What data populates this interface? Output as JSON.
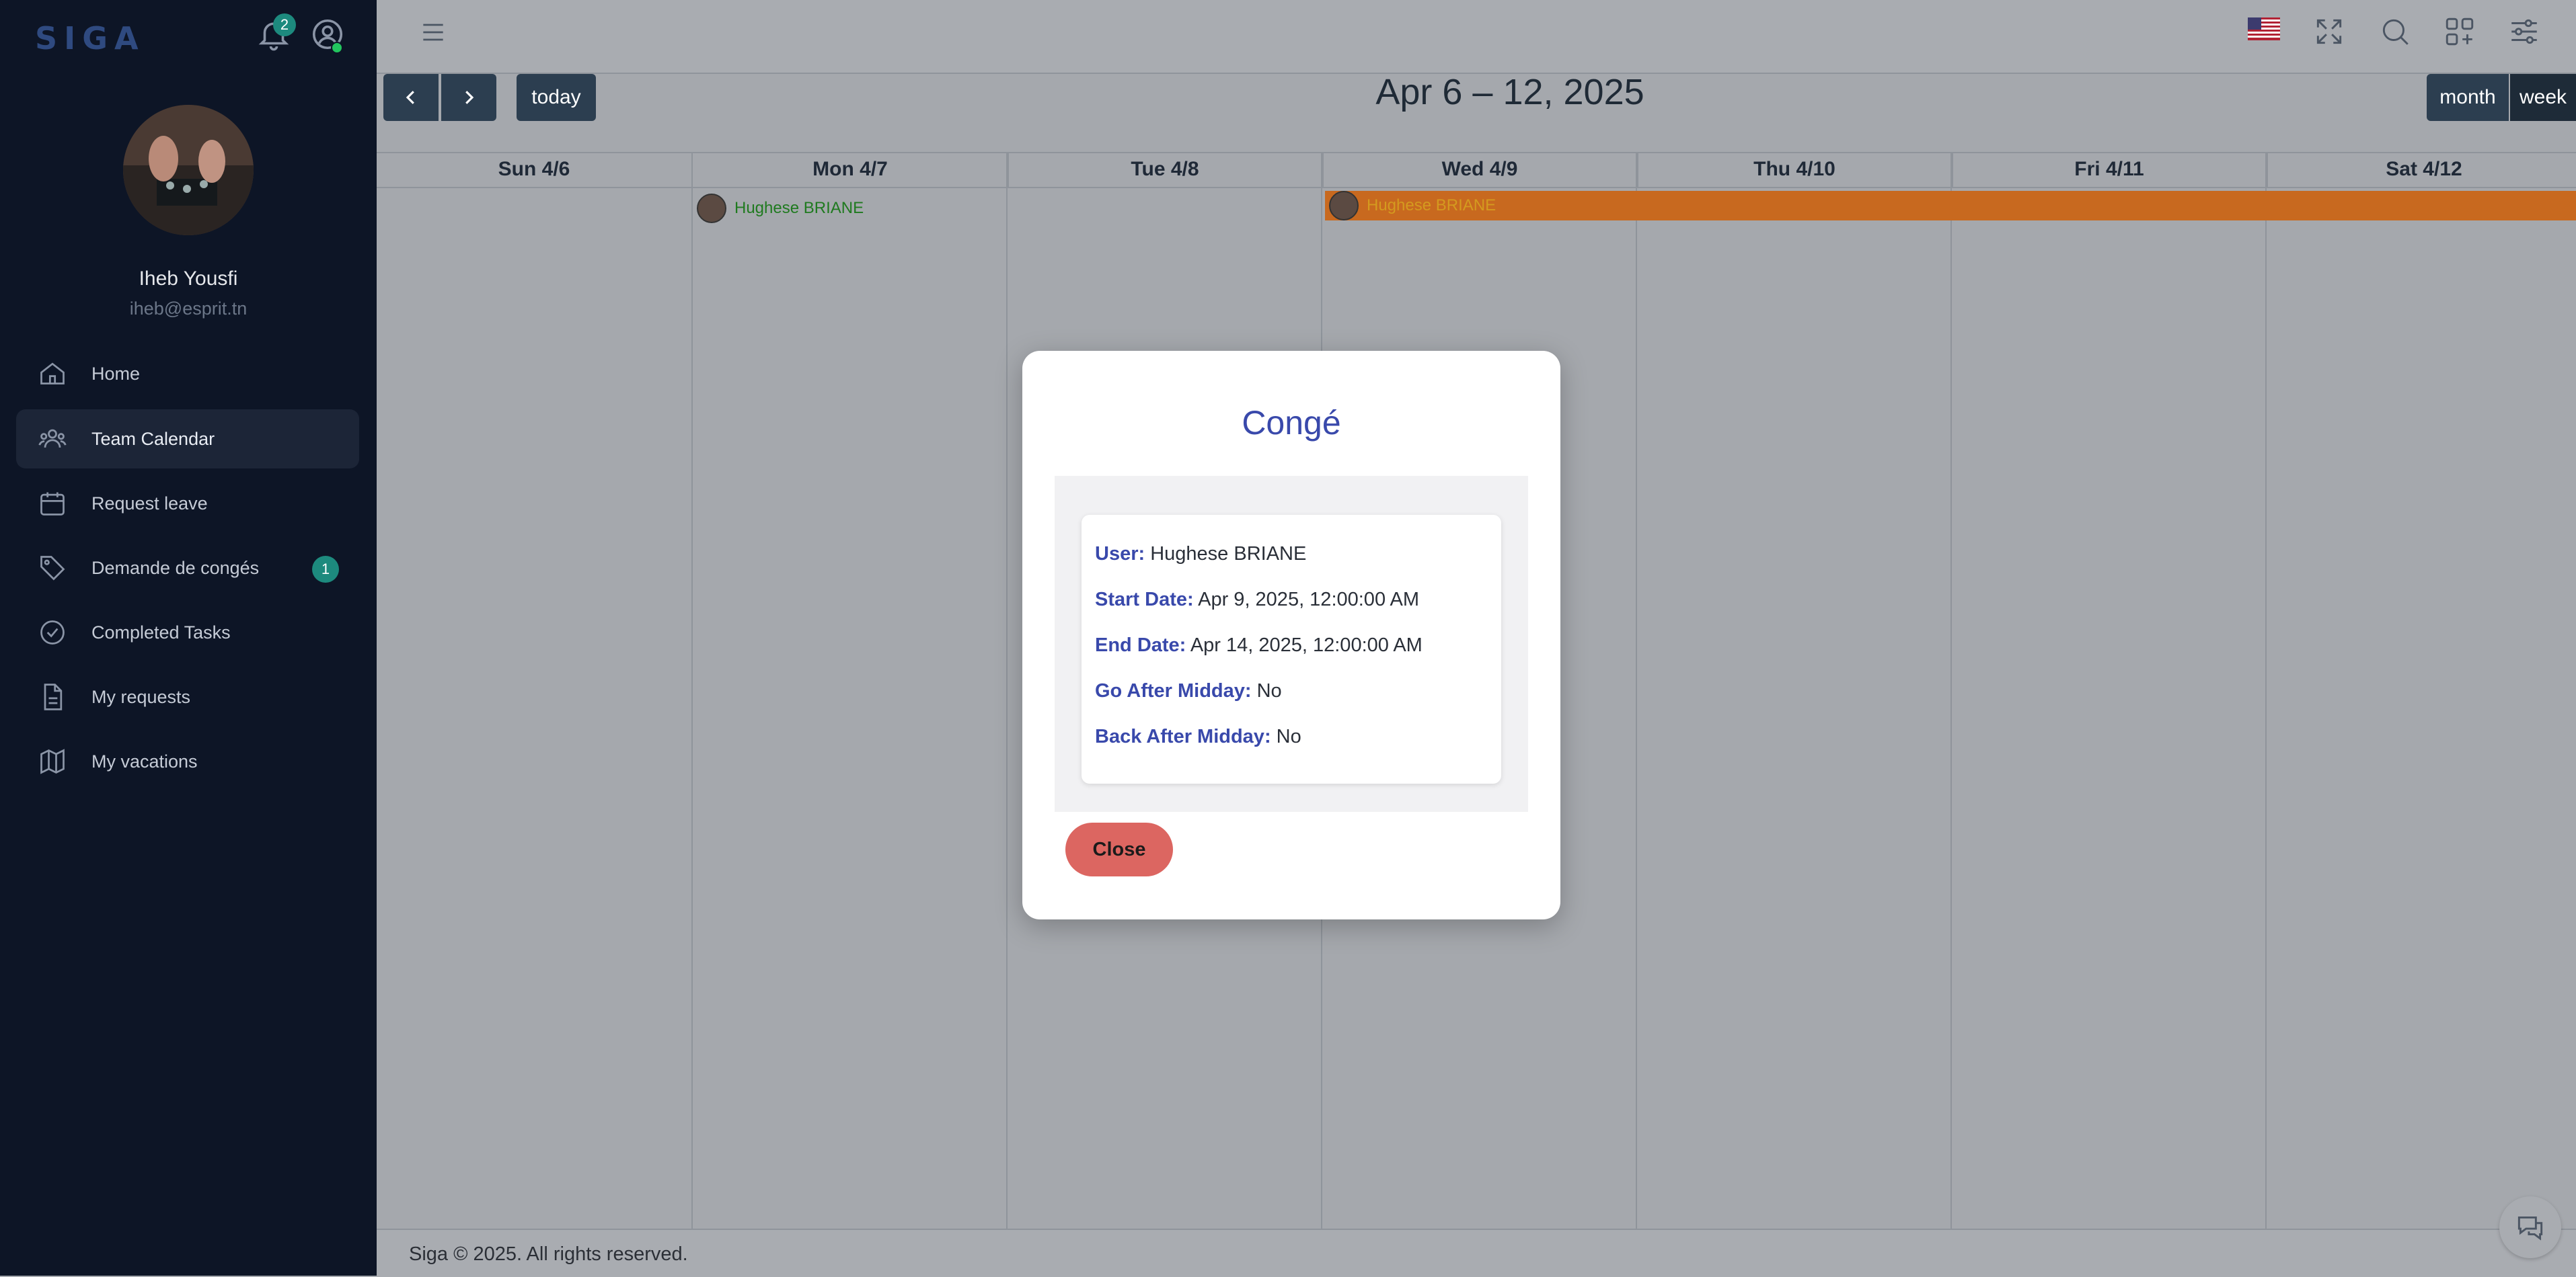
{
  "app": {
    "logo_text": "SIGA",
    "notification_count": "2"
  },
  "user": {
    "name": "Iheb Yousfi",
    "email": "iheb@esprit.tn"
  },
  "sidebar": {
    "items": [
      {
        "label": "Home",
        "icon": "home-icon"
      },
      {
        "label": "Team Calendar",
        "icon": "users-icon",
        "active": true
      },
      {
        "label": "Request leave",
        "icon": "calendar-icon"
      },
      {
        "label": "Demande de congés",
        "icon": "tag-icon",
        "badge": "1"
      },
      {
        "label": "Completed Tasks",
        "icon": "check-circle-icon"
      },
      {
        "label": "My requests",
        "icon": "document-icon"
      },
      {
        "label": "My vacations",
        "icon": "map-icon"
      }
    ]
  },
  "calendar": {
    "today_label": "today",
    "title": "Apr 6 – 12, 2025",
    "view_month": "month",
    "view_week": "week",
    "days": [
      "Sun 4/6",
      "Mon 4/7",
      "Tue 4/8",
      "Wed 4/9",
      "Thu 4/10",
      "Fri 4/11",
      "Sat 4/12"
    ],
    "events": [
      {
        "user": "Hughese BRIANE",
        "color": "#1f7a1f",
        "type": "dot"
      },
      {
        "user": "Hughese BRIANE",
        "color": "#c8691f",
        "type": "bar"
      }
    ]
  },
  "modal": {
    "title": "Congé",
    "user_label": "User:",
    "user_value": "Hughese BRIANE",
    "start_label": "Start Date:",
    "start_value": "Apr 9, 2025, 12:00:00 AM",
    "end_label": "End Date:",
    "end_value": "Apr 14, 2025, 12:00:00 AM",
    "go_label": "Go After Midday:",
    "go_value": "No",
    "back_label": "Back After Midday:",
    "back_value": "No",
    "close_label": "Close"
  },
  "footer": {
    "text": "Siga © 2025. All rights reserved."
  },
  "colors": {
    "sidebar_bg": "#0d1526",
    "accent": "#3949ab",
    "close_button": "#dc6661",
    "event_bar": "#c8691f"
  }
}
